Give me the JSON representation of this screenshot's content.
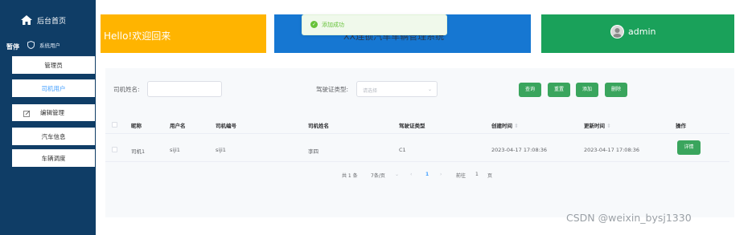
{
  "sidebar": {
    "home_label": "后台首页",
    "system_users_label": "系统用户",
    "pause_label": "暂停",
    "sub_items": [
      {
        "label": "管理员"
      },
      {
        "label": "司机用户"
      }
    ],
    "group_label": "编辑管理",
    "group_items": [
      {
        "label": "汽车信息"
      },
      {
        "label": "车辆调度"
      }
    ]
  },
  "banners": {
    "welcome": "Hello!欢迎回来",
    "system_name": "XX连锁汽车车辆管理系统",
    "username": "admin"
  },
  "toast": {
    "message": "添加成功"
  },
  "search": {
    "name_label": "司机姓名:",
    "name_value": "",
    "license_label": "驾驶证类型:",
    "license_placeholder": "请选择"
  },
  "buttons": {
    "query": "查询",
    "reset": "重置",
    "add": "添加",
    "delete": "删除"
  },
  "table": {
    "columns": [
      "昵称",
      "用户名",
      "司机编号",
      "司机姓名",
      "驾驶证类型",
      "创建时间",
      "更新时间",
      "操作"
    ],
    "rows": [
      {
        "nickname": "司机1",
        "username": "siji1",
        "driver_no": "siji1",
        "driver_name": "李四",
        "license_type": "C1",
        "created": "2023-04-17 17:08:36",
        "updated": "2023-04-17 17:08:36",
        "action": "详情"
      }
    ]
  },
  "pagination": {
    "total": "共 1 条",
    "page_size": "7条/页",
    "current": "1",
    "goto_label": "前往",
    "goto_value": "1",
    "page_suffix": "页"
  },
  "watermark": "CSDN @weixin_bysj1330",
  "colors": {
    "sidebar": "#0f3d66",
    "yellow": "#ffb400",
    "blue": "#1677d2",
    "green": "#1aa15a",
    "button": "#3aa55d",
    "active_menu": "#409eff"
  }
}
